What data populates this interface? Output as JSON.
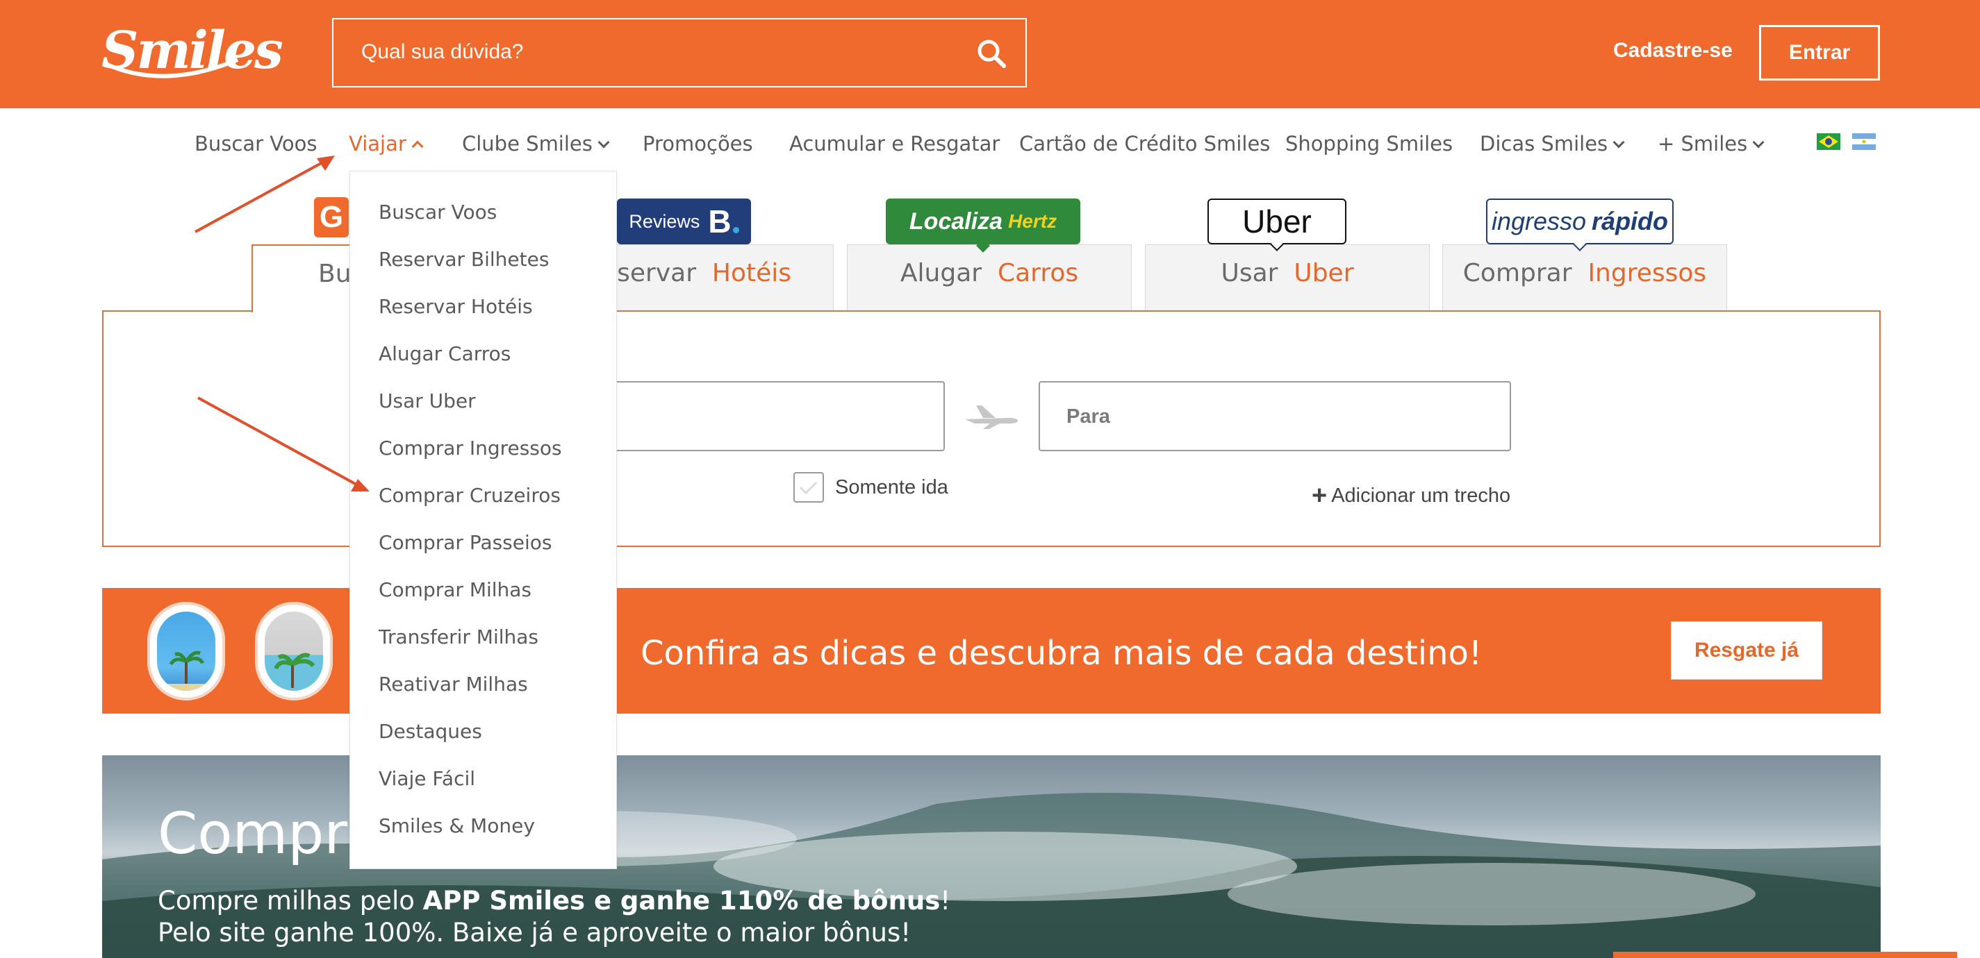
{
  "header": {
    "logo_text": "Smiles",
    "search_placeholder": "Qual sua dúvida?",
    "signup_label": "Cadastre-se",
    "login_label": "Entrar",
    "brand_color": "#ef6a2c"
  },
  "nav": {
    "items": [
      {
        "label": "Buscar Voos",
        "has_menu": false
      },
      {
        "label": "Viajar",
        "has_menu": true,
        "active": true
      },
      {
        "label": "Clube Smiles",
        "has_menu": true
      },
      {
        "label": "Promoções",
        "has_menu": false
      },
      {
        "label": "Acumular e Resgatar",
        "has_menu": false
      },
      {
        "label": "Cartão de Crédito Smiles",
        "has_menu": false
      },
      {
        "label": "Shopping Smiles",
        "has_menu": false
      },
      {
        "label": "Dicas Smiles",
        "has_menu": true
      },
      {
        "label": "+ Smiles",
        "has_menu": true
      }
    ],
    "flags": [
      "flag-brazil-icon",
      "flag-argentina-icon"
    ]
  },
  "dropdown": {
    "items": [
      "Buscar Voos",
      "Reservar Bilhetes",
      "Reservar Hotéis",
      "Alugar Carros",
      "Usar Uber",
      "Comprar Ingressos",
      "Comprar Cruzeiros",
      "Comprar Passeios",
      "Comprar Milhas",
      "Transferir Milhas",
      "Reativar Milhas",
      "Destaques",
      "Viaje Fácil",
      "Smiles & Money"
    ]
  },
  "tabs": [
    {
      "verb": "Bu",
      "noun": "",
      "badge": "G"
    },
    {
      "verb": "eservar",
      "noun": "Hotéis",
      "badge": "Reviews"
    },
    {
      "verb": "Alugar",
      "noun": "Carros",
      "badge": "Localiza",
      "badge_extra": "Hertz"
    },
    {
      "verb": "Usar",
      "noun": "Uber",
      "badge": "Uber"
    },
    {
      "verb": "Comprar",
      "noun": "Ingressos",
      "badge": "ingresso",
      "badge_extra": "rápido"
    }
  ],
  "booking_b": "B",
  "form": {
    "to_placeholder": "Para",
    "one_way_label": "Somente ida",
    "add_leg_label": "Adicionar um trecho"
  },
  "banner": {
    "text": "Confira as dicas e descubra mais de cada destino!",
    "button_label": "Resgate já"
  },
  "hero": {
    "title": "Compra",
    "sub1_prefix": "Compre milhas pelo ",
    "sub1_bold": "APP Smiles e ganhe 110% de bônus",
    "sub1_suffix": "!",
    "sub2": "Pelo site ganhe 100%. Baixe já e aproveite o maior bônus!"
  }
}
